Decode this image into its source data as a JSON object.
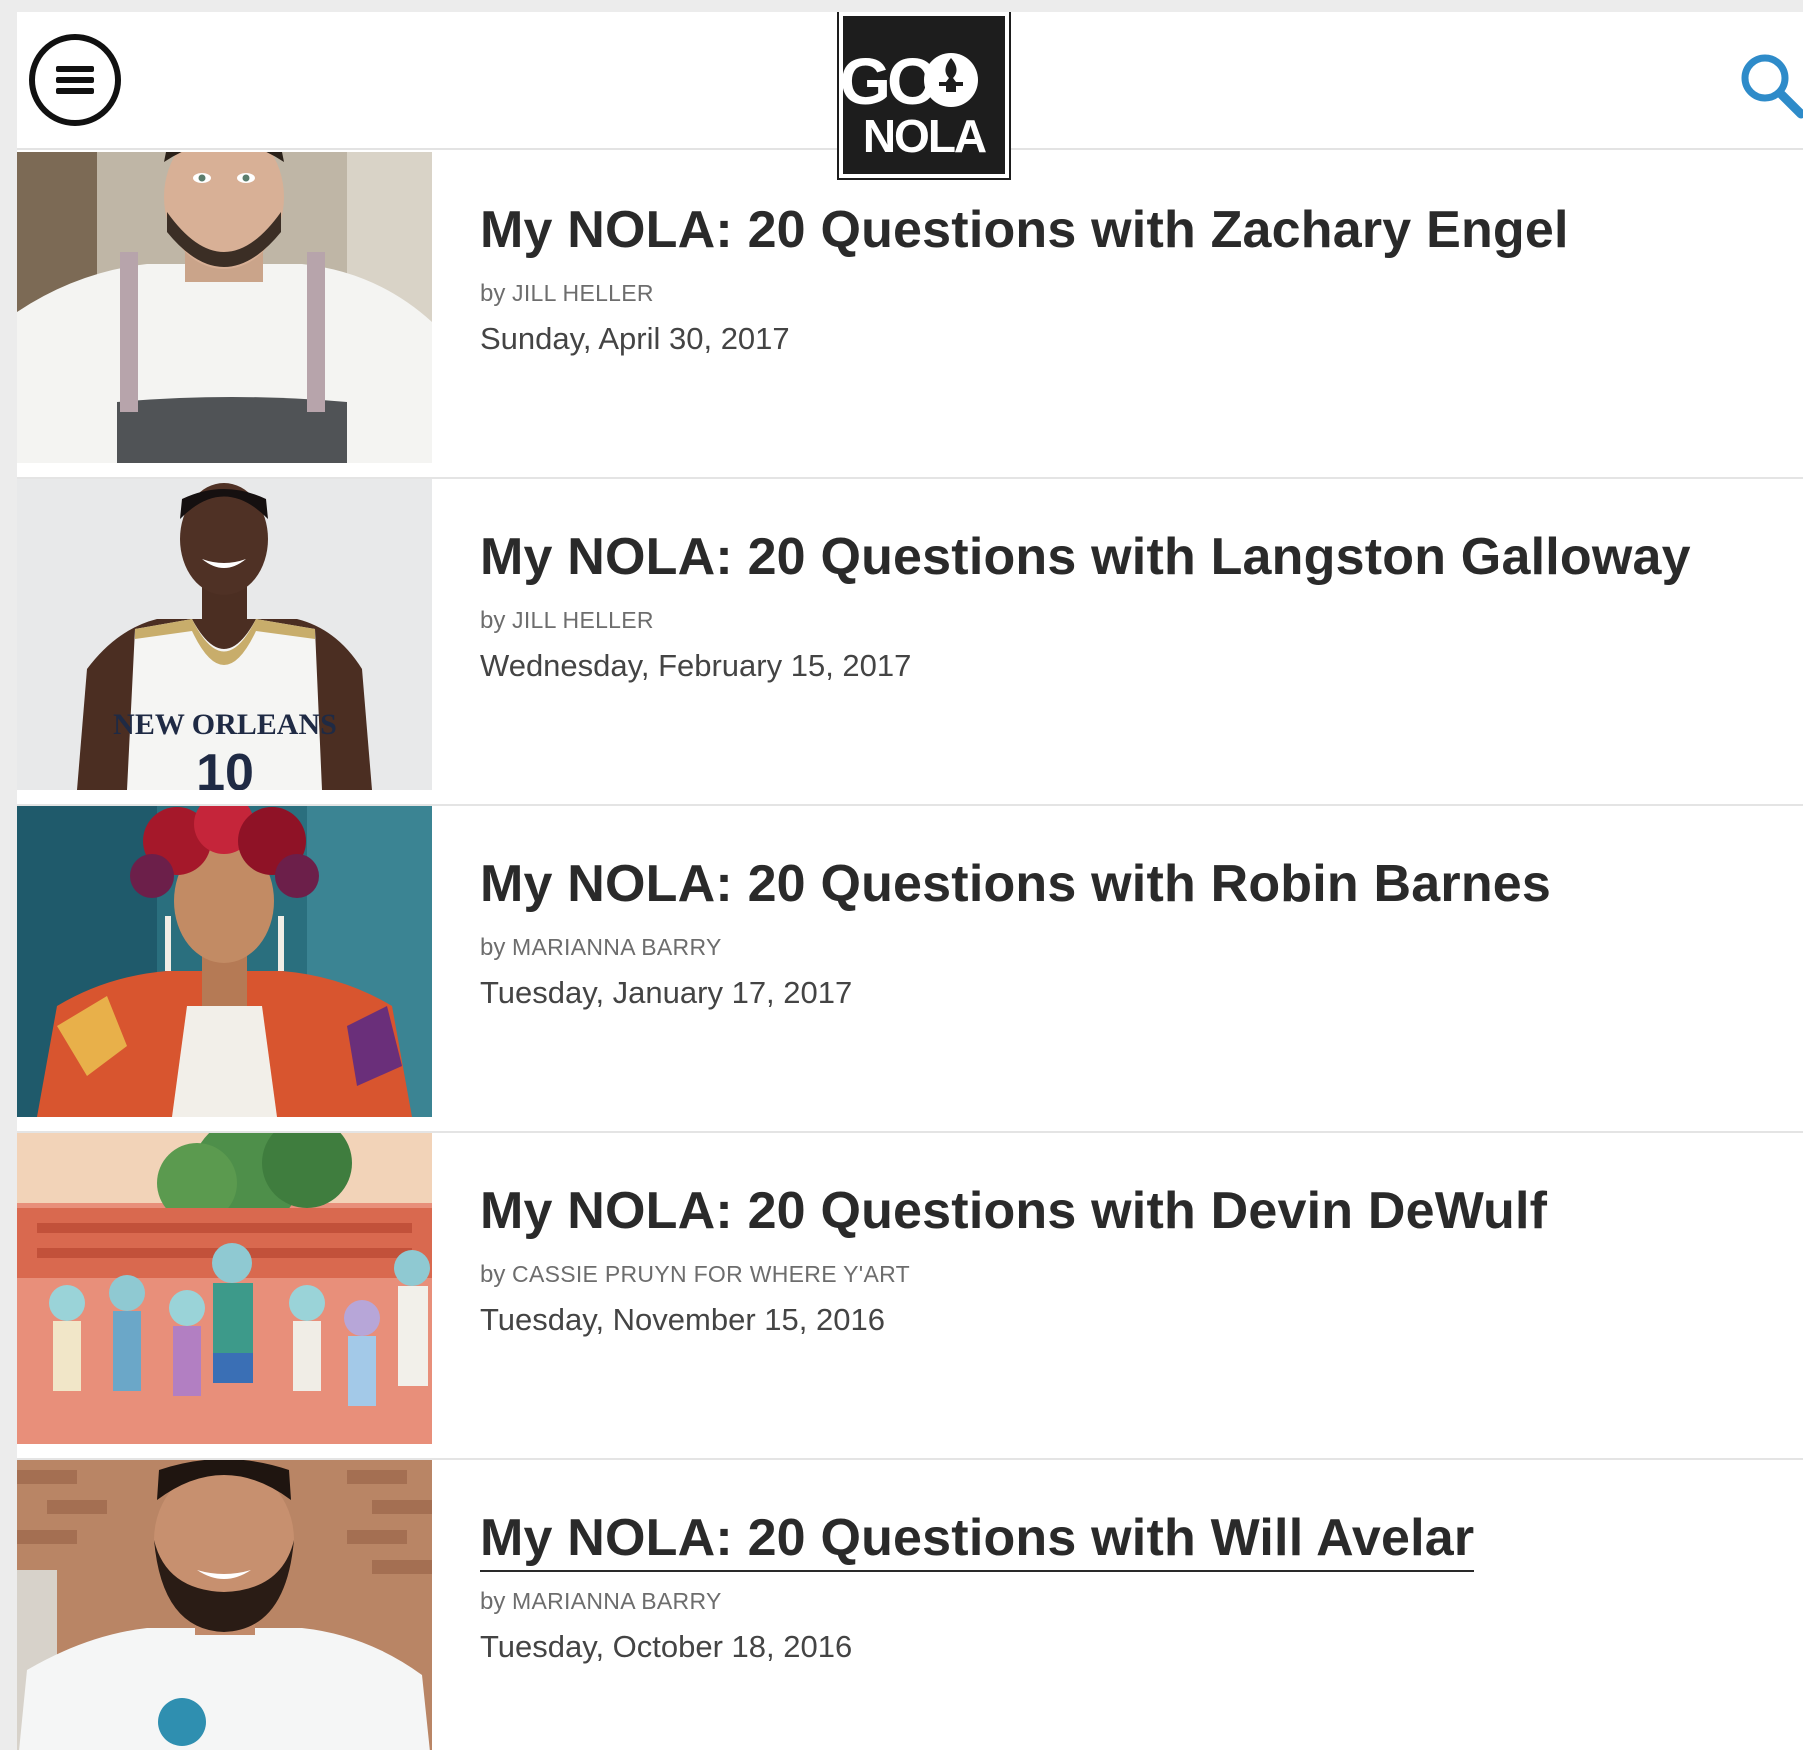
{
  "header": {
    "menu_icon": "hamburger-menu-icon",
    "logo_text_top": "GO",
    "logo_text_bottom": "NOLA",
    "search_icon": "search-icon",
    "accent_color": "#2e8bc9"
  },
  "articles": [
    {
      "title": "My NOLA: 20 Questions with Zachary Engel",
      "by": "by",
      "author": "Jill Heller",
      "date": "Sunday, April 30, 2017"
    },
    {
      "title": "My NOLA: 20 Questions with Langston Galloway",
      "by": "by",
      "author": "Jill Heller",
      "date": "Wednesday, February 15, 2017"
    },
    {
      "title": "My NOLA: 20 Questions with Robin Barnes",
      "by": "by",
      "author": "Marianna Barry",
      "date": "Tuesday, January 17, 2017"
    },
    {
      "title": "My NOLA: 20 Questions with Devin DeWulf",
      "by": "by",
      "author": "Cassie Pruyn for Where Y'Art",
      "date": "Tuesday, November 15, 2016"
    },
    {
      "title": "My NOLA: 20 Questions with Will Avelar",
      "by": "by",
      "author": "Marianna Barry",
      "date": "Tuesday, October 18, 2016"
    }
  ]
}
